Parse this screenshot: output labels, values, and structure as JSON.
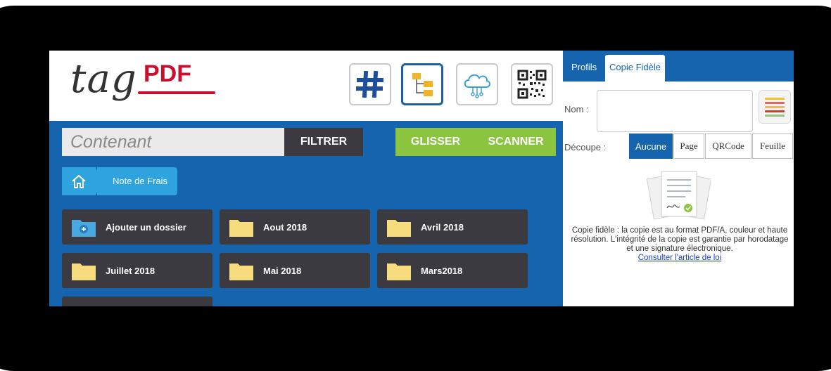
{
  "logo": {
    "part1": "tag",
    "part2": "PDF"
  },
  "toolbar": {
    "icons": [
      "hashtag-icon",
      "folder-tree-icon",
      "cloud-network-icon",
      "qr-code-icon"
    ]
  },
  "search": {
    "value": "Contenant"
  },
  "buttons": {
    "filter": "FILTRER",
    "drag": "GLISSER",
    "scan": "SCANNER"
  },
  "breadcrumb": {
    "current": "Note de Frais"
  },
  "folders": [
    {
      "label": "Ajouter un dossier",
      "icon": "add-folder-icon"
    },
    {
      "label": "Aout 2018",
      "icon": "folder-icon"
    },
    {
      "label": "Avril 2018",
      "icon": "folder-icon"
    },
    {
      "label": "Juillet 2018",
      "icon": "folder-icon"
    },
    {
      "label": "Mai 2018",
      "icon": "folder-icon"
    },
    {
      "label": "Mars2018",
      "icon": "folder-icon"
    },
    {
      "label": "",
      "icon": "folder-icon"
    }
  ],
  "panel": {
    "tabs": [
      "Profils",
      "Copie Fidèle"
    ],
    "nom_label": "Nom :",
    "decoupe_label": "Découpe :",
    "decoupe_options": [
      "Aucune",
      "Page",
      "QRCode",
      "Feuille"
    ],
    "selected": "Aucune",
    "description": "Copie fidèle : la copie est au format PDF/A, couleur et haute résolution. L'intégrité de la copie est garantie par horodatage et une signature électronique.",
    "link": "Consulter l'article de loi"
  },
  "colors": {
    "primary": "#1564ad",
    "green": "#8bc43f",
    "dark": "#3a3a40",
    "breadcrumb": "#2ea3de",
    "folder": "#f7dc7d",
    "logo_red": "#c8102e"
  }
}
